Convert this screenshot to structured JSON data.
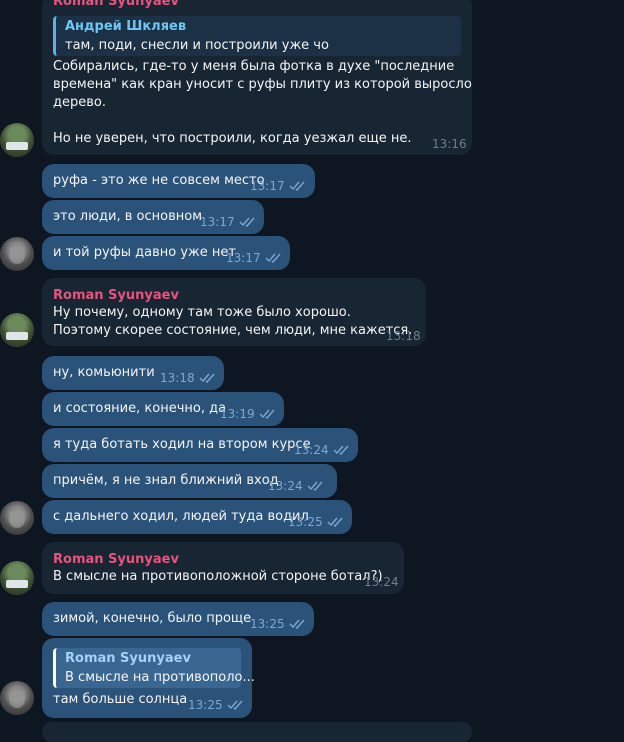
{
  "messages": [
    {
      "author": "Roman Syunyaev",
      "quote_author": "Андрей Шкляев",
      "quote_text": "там, поди, снесли и построили уже чо",
      "lines": [
        "Собирались, где-то у меня была фотка в духе \"последние",
        "времена\" как кран уносит с руфы плиту из которой выросло",
        "дерево.",
        "",
        "Но не уверен, что построили, когда уезжал еще не."
      ],
      "time": "13:16"
    },
    {
      "text": "руфа - это же не совсем место",
      "time": "13:17"
    },
    {
      "text": "это люди, в основном",
      "time": "13:17"
    },
    {
      "text": "и той руфы давно уже нет",
      "time": "13:17"
    },
    {
      "author": "Roman Syunyaev",
      "lines": [
        "Ну почему, одному там тоже было хорошо.",
        "Поэтому скорее состояние, чем люди, мне кажется."
      ],
      "time": "13:18"
    },
    {
      "text": "ну, комьюнити",
      "time": "13:18"
    },
    {
      "text": "и состояние, конечно, да",
      "time": "13:19"
    },
    {
      "text": "я туда ботать ходил на втором курсе",
      "time": "13:24"
    },
    {
      "text": "причём, я не знал ближний вход",
      "time": "13:24"
    },
    {
      "text": "с дальнего ходил, людей туда водил",
      "time": "13:25"
    },
    {
      "author": "Roman Syunyaev",
      "text": "В смысле на противоположной стороне ботал?)",
      "time": "13:24"
    },
    {
      "text": "зимой, конечно, было проще",
      "time": "13:25"
    },
    {
      "quote_author": "Roman Syunyaev",
      "quote_text": "В смысле на противополо...",
      "text": "там больше солнца",
      "time": "13:25"
    }
  ],
  "colors": {
    "background": "#0e1621",
    "incoming": "#182533",
    "outgoing": "#2b5278",
    "author": "#e9527c"
  },
  "icons": {
    "read": "double-check-icon"
  }
}
